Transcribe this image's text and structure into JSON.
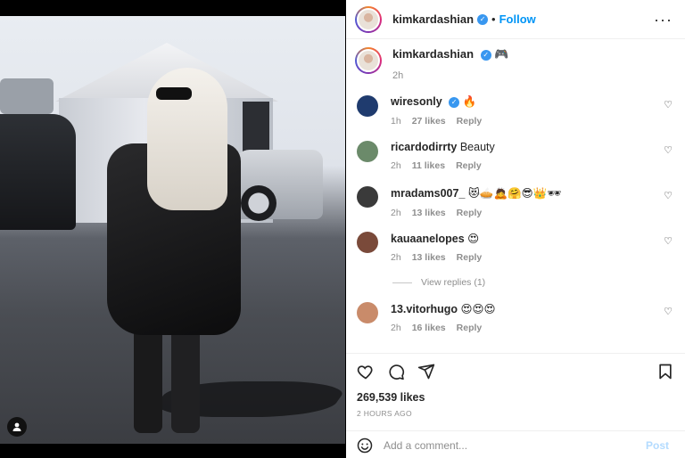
{
  "post": {
    "username": "kimkardashian",
    "follow_label": "Follow",
    "separator": "•",
    "more_label": "···"
  },
  "caption": {
    "username": "kimkardashian",
    "text": "🎮",
    "time": "2h"
  },
  "comments": [
    {
      "username": "wiresonly",
      "verified": true,
      "text": "🔥",
      "time": "1h",
      "likes": "27 likes",
      "reply": "Reply",
      "avatar_color": "#1f3b6e"
    },
    {
      "username": "ricardodirrty",
      "verified": false,
      "text": "Beauty",
      "time": "2h",
      "likes": "11 likes",
      "reply": "Reply",
      "avatar_color": "#6b8a6a"
    },
    {
      "username": "mradams007_",
      "verified": false,
      "text": "😻🥧🙇🤗😎👑🕶",
      "time": "2h",
      "likes": "13 likes",
      "reply": "Reply",
      "avatar_color": "#3a3a3a"
    },
    {
      "username": "kauaanelopes",
      "verified": false,
      "text": "😍",
      "time": "2h",
      "likes": "13 likes",
      "reply": "Reply",
      "avatar_color": "#7a4a3a"
    },
    {
      "username": "13.vitorhugo",
      "verified": false,
      "text": "😍😍😍",
      "time": "2h",
      "likes": "16 likes",
      "reply": "Reply",
      "avatar_color": "#c98b6a"
    }
  ],
  "view_replies": "View replies (1)",
  "actions": {
    "likes": "269,539 likes",
    "time_ago": "2 HOURS AGO",
    "comment_placeholder": "Add a comment...",
    "post_label": "Post"
  },
  "colors": {
    "accent": "#0095f6",
    "post_disabled": "#b3dbff",
    "verified": "#3897f0"
  }
}
